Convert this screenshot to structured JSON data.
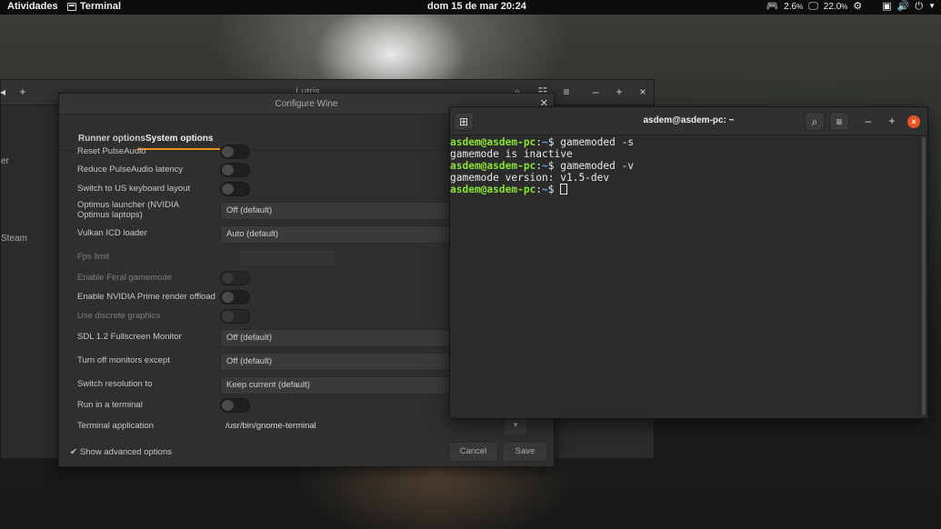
{
  "topbar": {
    "activities": "Atividades",
    "app_name": "Terminal",
    "clock": "dom 15 de mar  20:24",
    "cpu": "2.6",
    "mem": "22.0",
    "pct": "%"
  },
  "lutris": {
    "title": "Lutris",
    "sidebar": [
      "er",
      "Steam"
    ]
  },
  "dialog": {
    "title": "Configure Wine",
    "tabs": [
      "Runner options",
      "System options"
    ],
    "rows": {
      "reset_pulse": "Reset PulseAudio",
      "reduce_pulse": "Reduce PulseAudio latency",
      "us_keyboard": "Switch to US keyboard layout",
      "optimus": "Optimus launcher (NVIDIA Optimus laptops)",
      "optimus_val": "Off  (default)",
      "vulkan": "Vulkan ICD loader",
      "vulkan_val": "Auto  (default)",
      "fps": "Fps limit",
      "feral": "Enable Feral gamemode",
      "nvidia_prime": "Enable NVIDIA Prime render offload",
      "discrete": "Use discrete graphics",
      "sdl": "SDL 1.2 Fullscreen Monitor",
      "sdl_val": "Off  (default)",
      "monitors": "Turn off monitors except",
      "monitors_val": "Off  (default)",
      "resolution": "Switch resolution to",
      "resolution_val": "Keep current  (default)",
      "run_terminal": "Run in a terminal",
      "term_app": "Terminal application",
      "term_app_val": "/usr/bin/gnome-terminal"
    },
    "advanced": "Show advanced options",
    "cancel": "Cancel",
    "save": "Save"
  },
  "terminal": {
    "title": "asdem@asdem-pc: ~",
    "lines": [
      {
        "user": "asdem@asdem-pc",
        "sep": ":",
        "path": "~",
        "cmd": "$ gamemoded -s"
      },
      {
        "out": "gamemode is inactive"
      },
      {
        "user": "asdem@asdem-pc",
        "sep": ":",
        "path": "~",
        "cmd": "$ gamemoded -v"
      },
      {
        "out": "gamemode version: v1.5-dev"
      },
      {
        "user": "asdem@asdem-pc",
        "sep": ":",
        "path": "~",
        "cmd": "$ "
      }
    ]
  }
}
